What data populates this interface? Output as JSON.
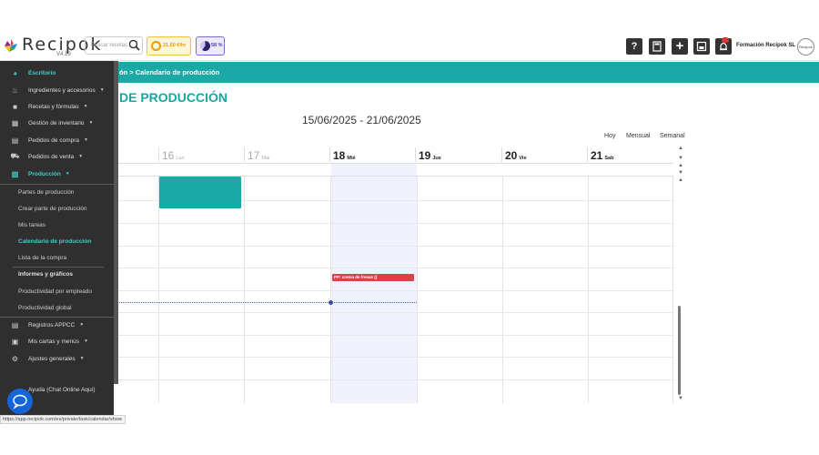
{
  "app": {
    "logo_text": "Recipok",
    "version": "V4.19",
    "search_placeholder": "Buscar recetas...",
    "price_pill": "21,60 €/hr",
    "percent_pill": "58 %",
    "company": "Formación Recipok SL",
    "avatar_text": "Recipok",
    "toolbar_icons": [
      "help-icon",
      "calculator-icon",
      "plus-icon",
      "save-icon",
      "bell-icon"
    ],
    "help_glyph": "?",
    "plus_glyph": "+"
  },
  "breadcrumb": "ón  >  Calendario de producción",
  "page_title": "DE PRODUCCIÓN",
  "calendar": {
    "range": "15/06/2025 - 21/06/2025",
    "views": [
      "Hoy",
      "Mensual",
      "Semanal"
    ],
    "days": [
      {
        "num": "16",
        "name": "Lun",
        "bold": false
      },
      {
        "num": "17",
        "name": "Mar",
        "bold": false
      },
      {
        "num": "18",
        "name": "Mié",
        "bold": true
      },
      {
        "num": "19",
        "name": "Jue",
        "bold": true
      },
      {
        "num": "20",
        "name": "Vie",
        "bold": true
      },
      {
        "num": "21",
        "name": "Sab",
        "bold": true
      }
    ],
    "events": [
      {
        "label": "",
        "color": "#1aa9a4",
        "day": "16"
      },
      {
        "label": "PP: crema de fresas ()",
        "color": "#d64545",
        "day": "18"
      }
    ]
  },
  "sidebar": {
    "items": [
      {
        "label": "Escritorio",
        "icon": "dashboard-icon",
        "active": true,
        "caret": false
      },
      {
        "label": "Ingredientes y accesorios",
        "icon": "ingredients-icon",
        "active": false,
        "caret": true
      },
      {
        "label": "Recetas y fórmulas",
        "icon": "recipe-icon",
        "active": false,
        "caret": true
      },
      {
        "label": "Gestión de inventario",
        "icon": "inventory-icon",
        "active": false,
        "caret": true
      },
      {
        "label": "Pedidos de compra",
        "icon": "purchase-icon",
        "active": false,
        "caret": true
      },
      {
        "label": "Pedidos de venta",
        "icon": "cart-icon",
        "active": false,
        "caret": true
      },
      {
        "label": "Producción",
        "icon": "production-icon",
        "active": true,
        "caret": true
      }
    ],
    "production_sub": [
      {
        "label": "Partes de producción",
        "active": false
      },
      {
        "label": "Crear parte de producción",
        "active": false
      },
      {
        "label": "Mis tareas",
        "active": false
      },
      {
        "label": "Calendario de producción",
        "active": true
      },
      {
        "label": "Lista de la compra",
        "active": false
      }
    ],
    "reports_heading": "Informes y gráficos",
    "reports_sub": [
      "Productividad por empleado",
      "Productividad global"
    ],
    "lower_items": [
      {
        "label": "Registros APPCC",
        "icon": "appcc-icon"
      },
      {
        "label": "Mis cartas y menús",
        "icon": "menu-icon"
      },
      {
        "label": "Ajustes generales",
        "icon": "settings-icon"
      }
    ],
    "help_item": "Ayuda (Chat Online Aquí)"
  },
  "status_url": "https://app.recipok.com/es/private/task/calendar/show"
}
